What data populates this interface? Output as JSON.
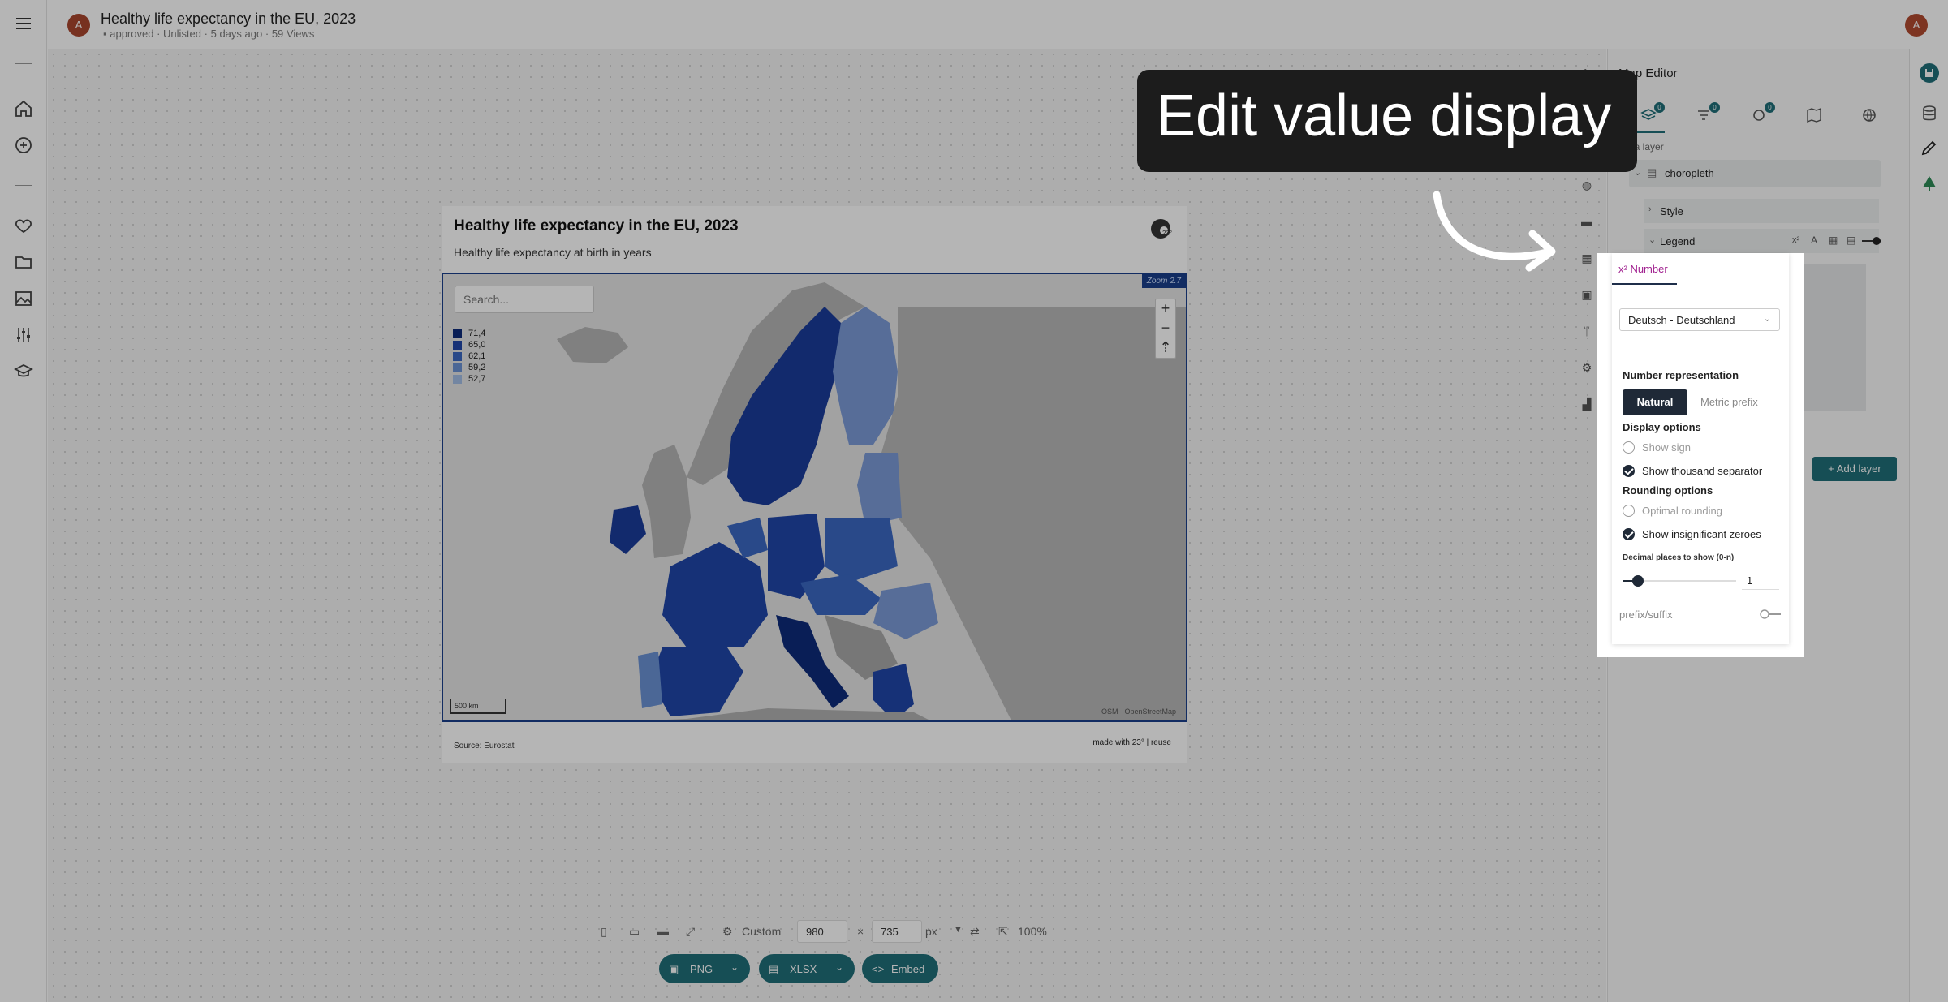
{
  "header": {
    "avatar_initial": "A",
    "title": "Healthy life expectancy in the EU, 2023",
    "meta": {
      "folder": "approved",
      "visibility": "Unlisted",
      "age": "5 days ago",
      "views": "59 Views",
      "sep": "·"
    },
    "user_initial": "A"
  },
  "chart": {
    "title": "Healthy life expectancy in the EU, 2023",
    "subtitle": "Healthy life expectancy at birth in years",
    "search_placeholder": "Search...",
    "zoom_label": "Zoom 2.7",
    "zoom_in": "+",
    "zoom_out": "−",
    "compass": "⇡",
    "scale": "500 km",
    "attribution": "OSM · OpenStreetMap",
    "source": "Source: Eurostat",
    "made_with": "made with 23° | reuse",
    "logo_text": "23°"
  },
  "legend": [
    {
      "label": "71,4",
      "color": "#0d2b7a"
    },
    {
      "label": "65,0",
      "color": "#1f46a8"
    },
    {
      "label": "62,1",
      "color": "#3a68c2"
    },
    {
      "label": "59,2",
      "color": "#6a92d4"
    },
    {
      "label": "52,7",
      "color": "#a2bde4"
    }
  ],
  "size_toolbar": {
    "preset": "Custom",
    "width": "980",
    "times": "×",
    "height": "735",
    "unit": "px",
    "zoom": "100%"
  },
  "export": {
    "png": "PNG",
    "xlsx": "XLSX",
    "embed": "Embed",
    "caret": "⌄"
  },
  "editor": {
    "title": "Map Editor",
    "tab_badges": [
      "0",
      "0",
      "0"
    ],
    "data_layer_label": "Data layer",
    "layer_name": "choropleth",
    "style_label": "Style",
    "legend_label": "Legend",
    "add_layer": "+ Add layer",
    "legend_tools": [
      "x²",
      "A"
    ]
  },
  "number_panel": {
    "tab": "x² Number",
    "locale": "Deutsch - Deutschland",
    "number_representation": "Number representation",
    "natural": "Natural",
    "metric_prefix": "Metric prefix",
    "display_options": "Display options",
    "show_sign": "Show sign",
    "show_thousand": "Show thousand separator",
    "rounding_options": "Rounding options",
    "optimal_rounding": "Optimal rounding",
    "show_zeroes": "Show insignificant zeroes",
    "decimal_label": "Decimal places to show (0-n)",
    "decimal_value": "1",
    "prefix_suffix": "prefix/suffix"
  },
  "callout": {
    "text": "Edit value display"
  },
  "colors": {
    "accent": "#1f6e78",
    "map_border": "#1a3f8a",
    "dark_button": "#1f2937",
    "tab_pink": "#a0208f"
  }
}
